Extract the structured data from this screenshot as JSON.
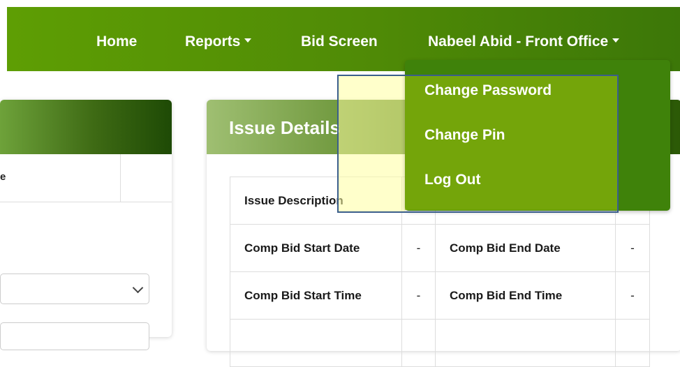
{
  "nav": {
    "home": "Home",
    "reports": "Reports",
    "bid_screen": "Bid Screen",
    "user_menu": "Nabeel Abid - Front Office"
  },
  "dropdown": {
    "items": [
      "Change Password",
      "Change Pin",
      "Log Out"
    ]
  },
  "left_panel": {
    "column_fragment": "e"
  },
  "issue_details": {
    "title": "Issue Details",
    "rows": [
      {
        "label": "Issue Description",
        "value": ""
      },
      {
        "label": "Comp Bid Start Date",
        "value": "-",
        "label2": "Comp Bid End Date",
        "value2": "-"
      },
      {
        "label": "Comp Bid Start Time",
        "value": "-",
        "label2": "Comp Bid End Time",
        "value2": "-"
      }
    ]
  },
  "colors": {
    "navbar": "#4f8a06",
    "dropdown": "#3f820a",
    "highlight_border": "#3a5e8c"
  }
}
